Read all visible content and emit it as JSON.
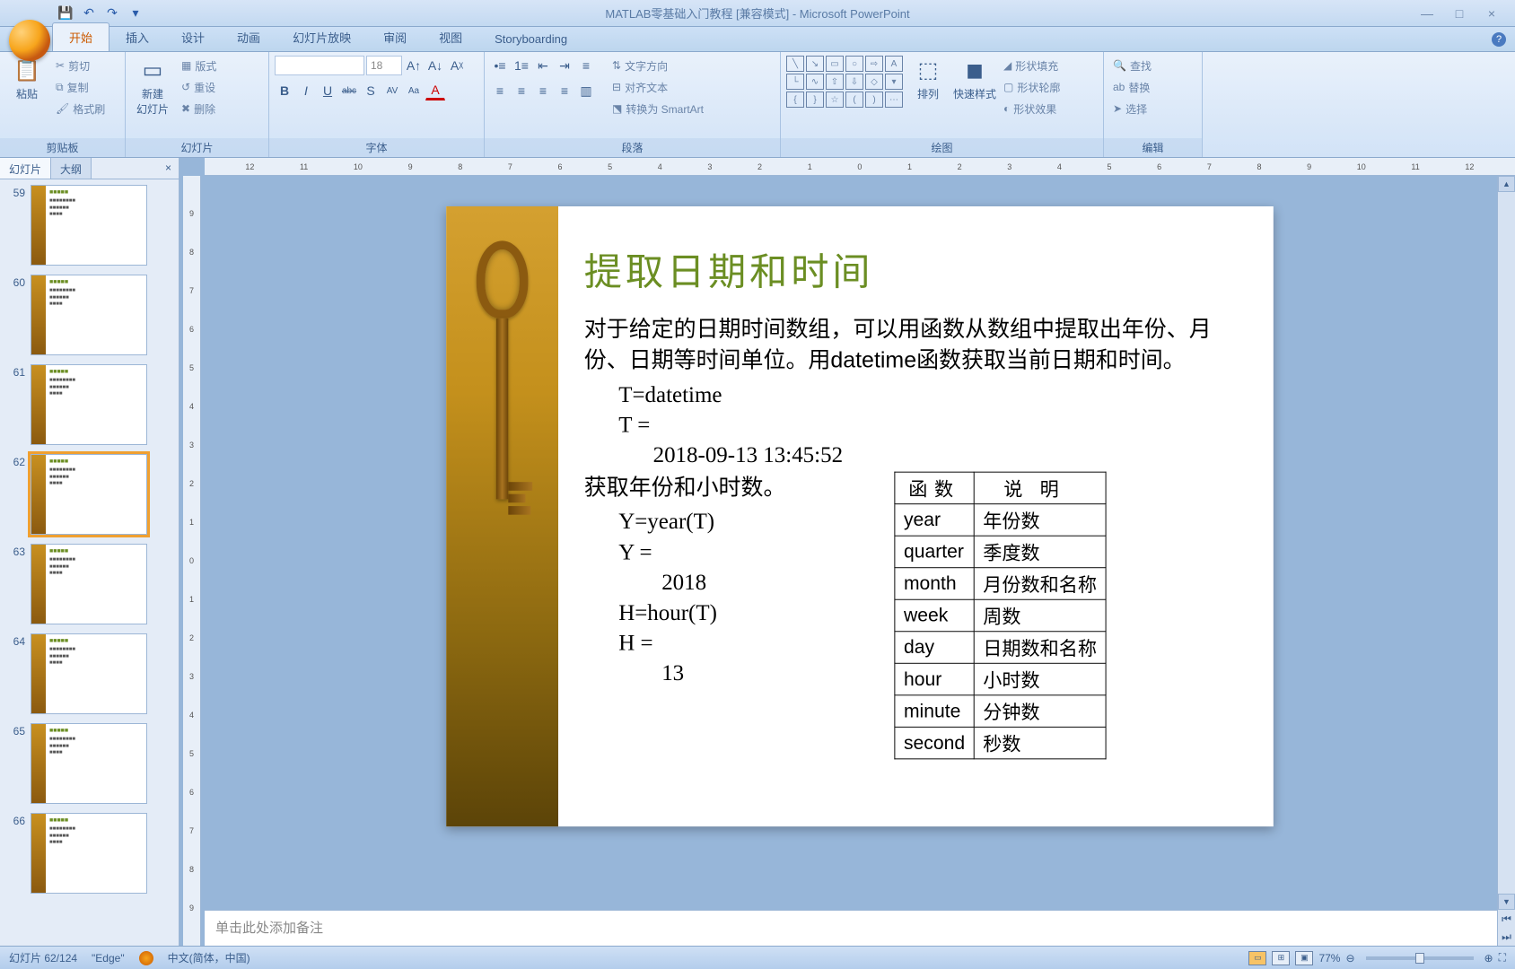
{
  "title": "MATLAB零基础入门教程 [兼容模式] - Microsoft PowerPoint",
  "qat": {
    "save": "💾",
    "undo": "↶",
    "redo": "↷"
  },
  "win": {
    "min": "—",
    "max": "□",
    "close": "×"
  },
  "tabs": [
    "开始",
    "插入",
    "设计",
    "动画",
    "幻灯片放映",
    "审阅",
    "视图",
    "Storyboarding"
  ],
  "ribbon": {
    "clipboard": {
      "label": "剪贴板",
      "paste": "粘贴",
      "cut": "剪切",
      "copy": "复制",
      "painter": "格式刷"
    },
    "slides": {
      "label": "幻灯片",
      "new": "新建\n幻灯片",
      "layout": "版式",
      "reset": "重设",
      "delete": "删除"
    },
    "font": {
      "label": "字体",
      "size": "18",
      "bold": "B",
      "italic": "I",
      "underline": "U",
      "strike": "abc",
      "shadow": "S",
      "spacing": "AV",
      "case": "Aa",
      "color": "A"
    },
    "para": {
      "label": "段落",
      "dir": "文字方向",
      "align": "对齐文本",
      "smart": "转换为 SmartArt"
    },
    "draw": {
      "label": "绘图",
      "arrange": "排列",
      "quick": "快速样式",
      "fill": "形状填充",
      "outline": "形状轮廓",
      "effects": "形状效果"
    },
    "edit": {
      "label": "编辑",
      "find": "查找",
      "replace": "替换",
      "select": "选择"
    }
  },
  "sideTabs": {
    "slides": "幻灯片",
    "outline": "大纲"
  },
  "thumbs": [
    {
      "n": "59",
      "sel": false
    },
    {
      "n": "60",
      "sel": false
    },
    {
      "n": "61",
      "sel": false
    },
    {
      "n": "62",
      "sel": true
    },
    {
      "n": "63",
      "sel": false
    },
    {
      "n": "64",
      "sel": false
    },
    {
      "n": "65",
      "sel": false
    },
    {
      "n": "66",
      "sel": false
    }
  ],
  "ruler_h": [
    "12",
    "11",
    "10",
    "9",
    "8",
    "7",
    "6",
    "5",
    "4",
    "3",
    "2",
    "1",
    "0",
    "1",
    "2",
    "3",
    "4",
    "5",
    "6",
    "7",
    "8",
    "9",
    "10",
    "11",
    "12"
  ],
  "ruler_v": [
    "9",
    "8",
    "7",
    "6",
    "5",
    "4",
    "3",
    "2",
    "1",
    "0",
    "1",
    "2",
    "3",
    "4",
    "5",
    "6",
    "7",
    "8",
    "9"
  ],
  "slide": {
    "title": "提取日期和时间",
    "p1": "对于给定的日期时间数组，可以用函数从数组中提取出年份、月份、日期等时间单位。用datetime函数获取当前日期和时间。",
    "c1": "T=datetime",
    "c2": "T =",
    "c3": "2018-09-13 13:45:52",
    "p2": "获取年份和小时数。",
    "c4": "Y=year(T)",
    "c5": "Y =",
    "c6": "2018",
    "c7": "H=hour(T)",
    "c8": "H =",
    "c9": "13",
    "table": {
      "h1": "函数",
      "h2": "说明",
      "rows": [
        [
          "year",
          "年份数"
        ],
        [
          "quarter",
          "季度数"
        ],
        [
          "month",
          "月份数和名称"
        ],
        [
          "week",
          "周数"
        ],
        [
          "day",
          "日期数和名称"
        ],
        [
          "hour",
          "小时数"
        ],
        [
          "minute",
          "分钟数"
        ],
        [
          "second",
          "秒数"
        ]
      ]
    }
  },
  "notes": "单击此处添加备注",
  "status": {
    "slide": "幻灯片 62/124",
    "theme": "\"Edge\"",
    "lang": "中文(简体，中国)",
    "zoom": "77%"
  }
}
